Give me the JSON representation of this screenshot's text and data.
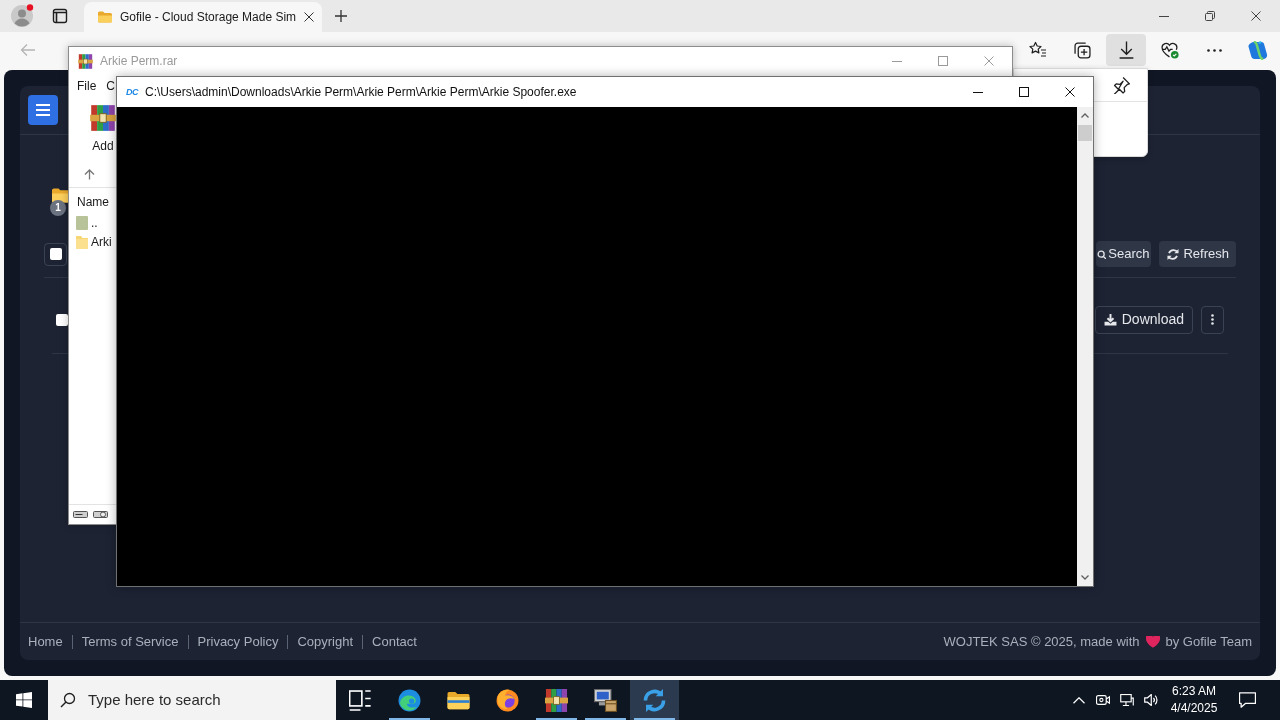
{
  "browser": {
    "tab": {
      "title": "Gofile - Cloud Storage Made Sim"
    },
    "toolbar_buttons": [
      {
        "kind": "favorites",
        "selected": false
      },
      {
        "kind": "collections",
        "selected": false
      },
      {
        "kind": "downloads",
        "selected": true
      },
      {
        "kind": "health",
        "selected": false
      },
      {
        "kind": "more",
        "selected": false
      },
      {
        "kind": "assistant",
        "selected": false
      }
    ]
  },
  "page": {
    "folder": {
      "badge": "1"
    },
    "select_all": {
      "checked": false
    },
    "actions": [
      {
        "kind": "search",
        "label": "Search"
      },
      {
        "kind": "refresh",
        "label": "Refresh"
      }
    ],
    "file_row": {
      "checked": false,
      "actions": [
        {
          "kind": "download",
          "label": "Download"
        },
        {
          "kind": "more"
        }
      ]
    },
    "footer": {
      "links": [
        "Home",
        "Terms of Service",
        "Privacy Policy",
        "Copyright",
        "Contact"
      ],
      "credit": "WOJTEK SAS © 2025, made with",
      "credit_end": "by Gofile Team"
    }
  },
  "archive_window": {
    "title": "Arkie Perm.rar",
    "active": false,
    "menu": [
      "File",
      "C"
    ],
    "tools": [
      {
        "label": "Add"
      }
    ],
    "columns": [
      "Name"
    ],
    "rows": [
      {
        "kind": "parent",
        "name": ".."
      },
      {
        "kind": "folder",
        "name": "Arki"
      }
    ]
  },
  "console_window": {
    "logo": "DC",
    "title": "C:\\Users\\admin\\Downloads\\Arkie Perm\\Arkie Perm\\Arkie Perm\\Arkie Spoofer.exe",
    "active": true
  },
  "taskbar": {
    "search": {
      "placeholder": "Type here to search"
    },
    "apps": [
      {
        "kind": "task_view",
        "running": false,
        "selected": false
      },
      {
        "kind": "web_browser",
        "running": true,
        "selected": false
      },
      {
        "kind": "file_manager",
        "running": false,
        "selected": false
      },
      {
        "kind": "fox_browser",
        "running": false,
        "selected": false
      },
      {
        "kind": "archiver",
        "running": true,
        "selected": false
      },
      {
        "kind": "setup",
        "running": true,
        "selected": false
      },
      {
        "kind": "console_app",
        "running": true,
        "selected": true
      }
    ],
    "clock": {
      "time": "6:23 AM",
      "date": "4/4/2025"
    }
  }
}
